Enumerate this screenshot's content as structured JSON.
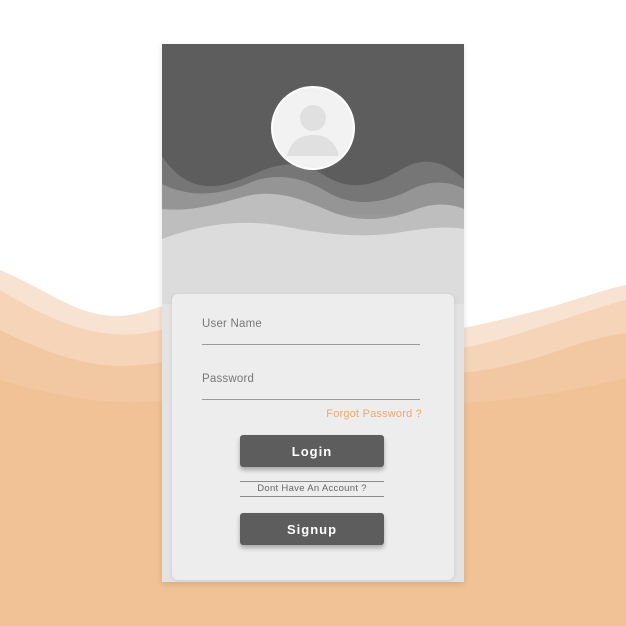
{
  "colors": {
    "background": "#ffffff",
    "peach_wave": "#f2c49c",
    "header_dark": "#5d5d5d",
    "panel": "#e3e3e3",
    "card": "#ededed",
    "button": "#5d5d5d",
    "button_text": "#ffffff",
    "accent_link": "#f0a868"
  },
  "icons": {
    "avatar": "user-silhouette-icon"
  },
  "form": {
    "username_label": "User Name",
    "password_label": "Password",
    "forgot_password": "Forgot Password ?",
    "login_label": "Login",
    "no_account_text": "Dont Have An Account ?",
    "signup_label": "Signup"
  }
}
